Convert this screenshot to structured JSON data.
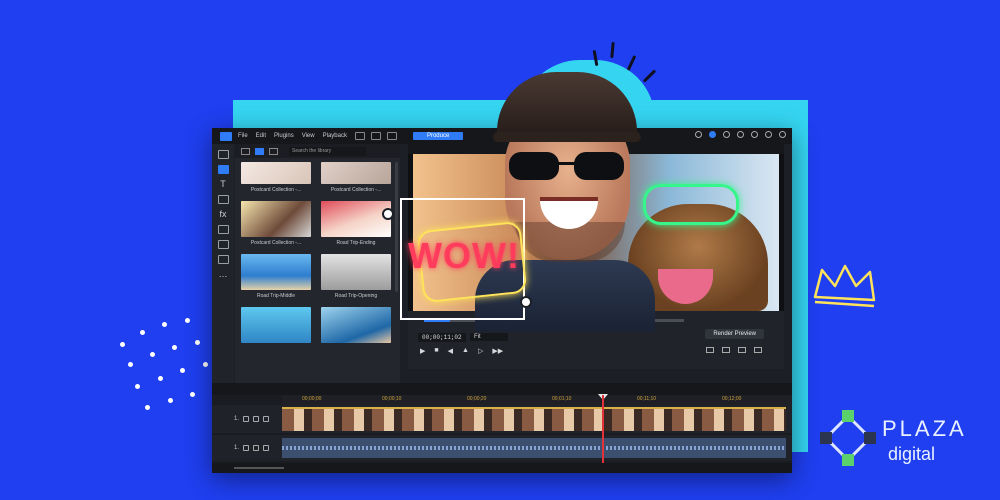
{
  "menubar": {
    "items": [
      "File",
      "Edit",
      "Plugins",
      "View",
      "Playback"
    ],
    "produce_label": "Produce"
  },
  "library": {
    "search_placeholder": "Search the library",
    "items": [
      {
        "label": "Postcard Collection -..."
      },
      {
        "label": "Postcard Collection -..."
      },
      {
        "label": "Postcard Collection -..."
      },
      {
        "label": "Road Trip-Ending"
      },
      {
        "label": "Road Trip-Middle"
      },
      {
        "label": "Road Trip-Opening"
      }
    ]
  },
  "preview": {
    "timecode": "00;00;11;02",
    "fit": "Fit",
    "render_label": "Render Preview",
    "progress": 0.1
  },
  "timeline": {
    "ruler": [
      "00;00;00",
      "00;00;10",
      "00;00;20",
      "00;01;10",
      "00;11;10",
      "00;12;00"
    ],
    "tracks": [
      {
        "label": "1."
      },
      {
        "label": "1."
      }
    ]
  },
  "overlay": {
    "sticker_text": "WOW!"
  },
  "brand": {
    "title": "PLAZA",
    "subtitle": "digital"
  },
  "colors": {
    "background": "#1f3ff0",
    "accent": "#2f7cf6",
    "cyan": "#35d5f2",
    "neon_green": "#36f58b",
    "neon_pink": "#ff3c5c",
    "neon_yellow": "#ffe35a"
  }
}
